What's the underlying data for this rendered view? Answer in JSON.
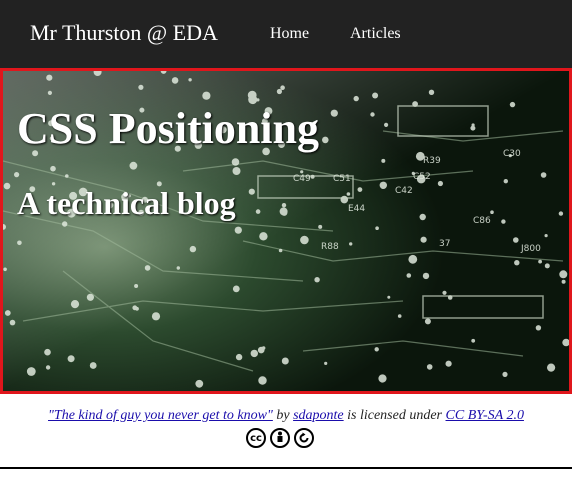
{
  "navbar": {
    "brand": "Mr Thurston @ EDA",
    "links": [
      {
        "label": "Home"
      },
      {
        "label": "Articles"
      }
    ]
  },
  "hero": {
    "title": "CSS Positioning",
    "subtitle": "A technical blog",
    "border_color": "#e0161c",
    "board_text": [
      "C49",
      "C51",
      "E44",
      "R88",
      "C86",
      "J800",
      "37",
      "C30",
      "R39",
      "C42",
      "C52"
    ]
  },
  "credit": {
    "photo_title": "\"The kind of guy you never get to know\"",
    "by_text": "by",
    "author": "sdaponte",
    "licensed_text": "is licensed under",
    "license": "CC BY-SA 2.0",
    "icons": [
      "cc-icon",
      "by-icon",
      "sa-icon"
    ]
  }
}
